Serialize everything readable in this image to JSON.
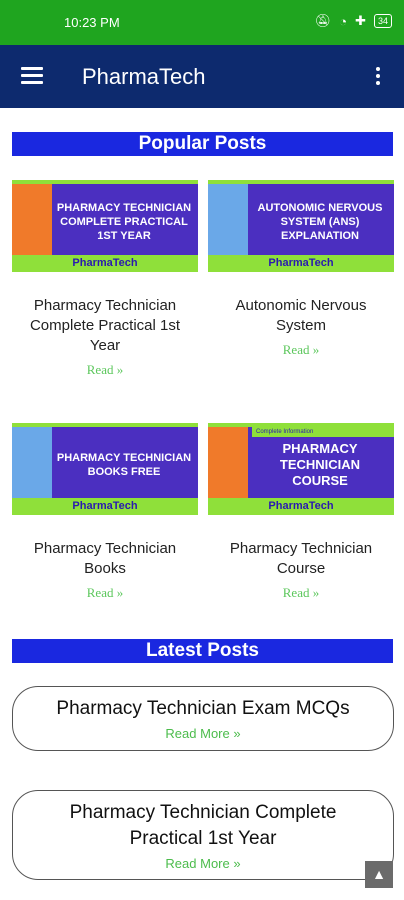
{
  "status_bar": {
    "time": "10:23 PM",
    "battery": "34"
  },
  "app_bar": {
    "title": "PharmaTech"
  },
  "popular": {
    "header": "Popular Posts",
    "posts": [
      {
        "title": "Pharmacy Technician Complete Practical 1st Year",
        "thumb_text": "PHARMACY TECHNICIAN COMPLETE PRACTICAL 1ST YEAR",
        "brand": "PharmaTech",
        "read": "Read »"
      },
      {
        "title": "Autonomic Nervous System",
        "thumb_text": "AUTONOMIC NERVOUS SYSTEM (ANS) EXPLANATION",
        "brand": "PharmaTech",
        "read": "Read »"
      },
      {
        "title": "Pharmacy Technician Books",
        "thumb_text": "PHARMACY TECHNICIAN BOOKS FREE",
        "brand": "PharmaTech",
        "read": "Read »"
      },
      {
        "title": "Pharmacy Technician Course",
        "thumb_text": "PHARMACY TECHNICIAN COURSE",
        "thumb_tag": "Complete Information",
        "brand": "PharmaTech",
        "read": "Read »"
      }
    ]
  },
  "latest": {
    "header": "Latest Posts",
    "posts": [
      {
        "title": "Pharmacy Technician Exam MCQs",
        "link": "Read More »"
      },
      {
        "title": "Pharmacy Technician Complete Practical 1st Year",
        "link": "Read More »"
      }
    ]
  },
  "colors": {
    "status_bar": "#1fa51f",
    "app_bar": "#0d2a6e",
    "section_header": "#1a28e0",
    "read_link": "#5cc75c"
  }
}
